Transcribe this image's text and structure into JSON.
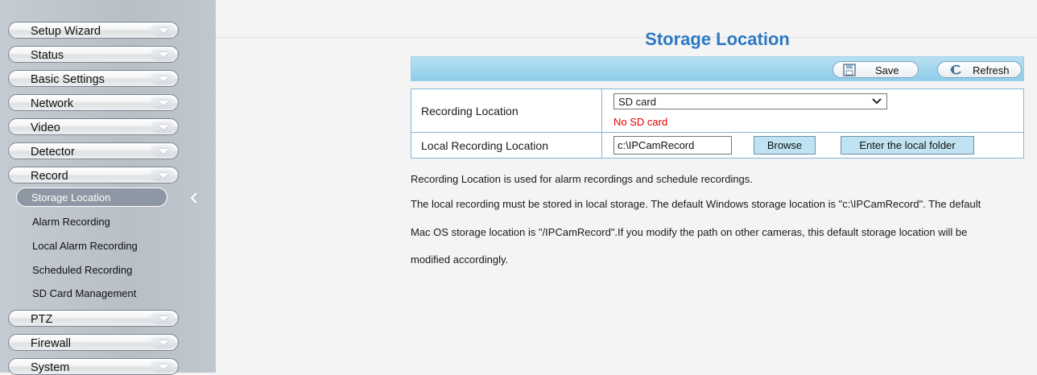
{
  "sidebar": {
    "menus": [
      {
        "label": "Setup Wizard"
      },
      {
        "label": "Status"
      },
      {
        "label": "Basic Settings"
      },
      {
        "label": "Network"
      },
      {
        "label": "Video"
      },
      {
        "label": "Detector"
      },
      {
        "label": "Record"
      }
    ],
    "record_submenu": [
      {
        "label": "Storage Location",
        "active": true
      },
      {
        "label": "Alarm Recording"
      },
      {
        "label": "Local Alarm Recording"
      },
      {
        "label": "Scheduled Recording"
      },
      {
        "label": "SD Card Management"
      }
    ],
    "menus_after": [
      {
        "label": "PTZ"
      },
      {
        "label": "Firewall"
      },
      {
        "label": "System"
      }
    ]
  },
  "page": {
    "title": "Storage Location",
    "title_color": "#2d79c3"
  },
  "toolbar": {
    "save_label": "Save",
    "save_icon": "floppy-icon",
    "refresh_label": "Refresh",
    "refresh_icon": "refresh-icon"
  },
  "settings": {
    "recording_location_label": "Recording Location",
    "recording_location_value": "SD card",
    "sd_status": "No SD card",
    "sd_status_color": "#e00000",
    "local_recording_label": "Local Recording Location",
    "local_recording_value": "c:\\IPCamRecord",
    "browse_label": "Browse",
    "enter_folder_label": "Enter the local folder"
  },
  "description": {
    "line1": "Recording Location is used for alarm recordings and schedule recordings.",
    "line2": "The local recording must be stored in local storage. The default Windows storage location is \"c:\\IPCamRecord\". The default",
    "line3": "Mac OS storage location is \"/IPCamRecord\".If you modify the path on other cameras, this default storage location will be",
    "line4": "modified accordingly."
  }
}
